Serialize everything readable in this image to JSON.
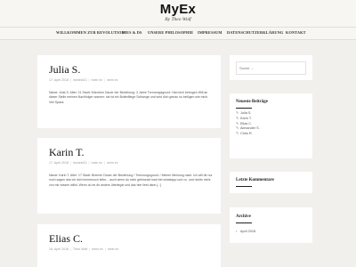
{
  "site": {
    "title": "MyEx",
    "subtitle": "By Theo Wolf"
  },
  "nav": {
    "items": [
      "WILLKOMMEN ZUR REVOLUTION!",
      "DIES & DS",
      "UNSERE PHILOSOPHIE",
      "IMPRESSUM",
      "DATENSCHUTZERKLÄRUNG",
      "KONTAKT"
    ]
  },
  "posts": [
    {
      "title": "Julia S.",
      "meta": {
        "date": "17. April 2018",
        "author": "ironieid13",
        "category": "mein ex",
        "tags": "mein ex"
      },
      "excerpt": "Name: Julia S. Alter: 21 Stadt: München Dauer der Beziehung: 3 Jahre Trennungsgrund: Hat mich betrogen Will an dieser Stelle meinen Nachfolger warnen: sie ist ein Butterfliege Schlange und wird dich genau so betügen wie mich. Viel Spass"
    },
    {
      "title": "Karin T.",
      "meta": {
        "date": "17. April 2018",
        "author": "ironieid13",
        "category": "mein ex",
        "tags": "mein ex"
      },
      "excerpt": "Name: Karin T. Alter: 17 Stadt: Bremen Dauer der Beziehung / Trennungsgrund: / Meiner Meinung nach: Ich will dir nur noch sagen das ich dich immernoch liebe... auch wenn du mich gebloeckt hast bei whatsapp und co. und nichts mehr von mir wissen willst. Wenn du es dir anders überlegst und das hier liest dann [...]"
    },
    {
      "title": "Elias C.",
      "meta": {
        "date": "16. April 2018",
        "author": "Theo Wolf",
        "category": "mein ex",
        "tags": "mein ex"
      },
      "excerpt": ""
    }
  ],
  "sidebar": {
    "search": {
      "placeholder": "Suche ..."
    },
    "recent": {
      "title": "Neueste Beiträge",
      "items": [
        "Julia S.",
        "Karin T.",
        "Elias C.",
        "Alexander S.",
        "Chris R."
      ]
    },
    "comments": {
      "title": "Letzte Kommentare"
    },
    "archive": {
      "title": "Archive",
      "items": [
        "April 2018"
      ]
    }
  },
  "colors": {
    "background": "#f1f0ed",
    "card": "#ffffff",
    "text": "#222222"
  },
  "icons": {
    "recent_item": "pencil-icon",
    "archive_item": "folder-icon"
  }
}
